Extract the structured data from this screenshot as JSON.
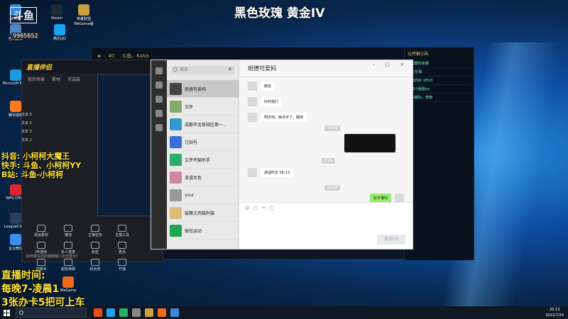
{
  "stream": {
    "title": "黑色玫瑰 黄金IV",
    "logo_badge": "斗鱼",
    "viewer_count": "9985652"
  },
  "overlays": {
    "socials": [
      "抖音: 小柯柯大魔王",
      "快手: 斗鱼、小柯柯YY",
      "B站: 斗鱼-小柯柯"
    ],
    "schedule": [
      "直播时间:",
      "每晚7-凌晨1",
      "3张办卡5把可上车"
    ]
  },
  "desktop_icons": [
    {
      "label": "此电脑",
      "color": "#3a8ad8"
    },
    {
      "label": "Steam",
      "color": "#1b2838"
    },
    {
      "label": "英雄联盟WeGame版",
      "color": "#c8a040"
    },
    {
      "label": "控制面板",
      "color": "#4f86c6"
    },
    {
      "label": "腾讯QQ",
      "color": "#1ea0f0"
    },
    {
      "label": "Microsoft Edge",
      "color": "#1a9be0"
    },
    {
      "label": "腾讯视频",
      "color": "#ff7a1c"
    },
    {
      "label": "WPS Office",
      "color": "#d8282e"
    },
    {
      "label": "LeagueClient",
      "color": "#2b3e5a"
    },
    {
      "label": "企业微信",
      "color": "#3c8ef0"
    },
    {
      "label": "WeGame",
      "color": "#f06a1c"
    }
  ],
  "helper": {
    "brand": "直播伴侣",
    "tabs": [
      "我的场景",
      "素材",
      "可选装"
    ],
    "scenes": [
      "文本 5",
      "文本 2",
      "文本 3",
      "文本 1"
    ],
    "tools": [
      "添加素材",
      "推流",
      "主播任务",
      "主播工具",
      "PK连线",
      "多人连麦",
      "抢星",
      "更多",
      "直播间",
      "超级弹幕",
      "粉丝团",
      "开播"
    ],
    "footer": "如何把左边的视频窗口点击放大?"
  },
  "wechat": {
    "search_placeholder": "搜索",
    "chats": [
      {
        "name": "斑德可爱妈",
        "sub": "",
        "color": "#444",
        "active": true
      },
      {
        "name": "文件",
        "sub": "",
        "color": "#8a6",
        "active": false
      },
      {
        "name": "成都市龙泉驿区第一...",
        "sub": "",
        "color": "#39c",
        "active": false
      },
      {
        "name": "订阅号",
        "sub": "",
        "color": "#3a6fd8",
        "active": false
      },
      {
        "name": "文件传输助手",
        "sub": "",
        "color": "#2aae67",
        "active": false
      },
      {
        "name": "浪漫月色",
        "sub": "",
        "color": "#c89",
        "active": false
      },
      {
        "name": "your",
        "sub": "",
        "color": "#999",
        "active": false
      },
      {
        "name": "鼓舞文西猫利猫",
        "sub": "",
        "color": "#db7",
        "active": false
      },
      {
        "name": "微信运动",
        "sub": "",
        "color": "#1fa653",
        "active": false
      }
    ],
    "chat_title": "斑德可爱妈",
    "window_buttons": "– □ ×",
    "messages": [
      {
        "text": "微信",
        "side": "left"
      },
      {
        "text": "好的我们",
        "side": "left"
      },
      {
        "text": "明天吧，两点半了，睡吧",
        "side": "left"
      },
      {
        "text": "通话时长 56:13",
        "side": "left"
      },
      {
        "text": "玩不懂吗",
        "side": "right"
      }
    ],
    "time_tags": [
      "18:01",
      "7:24",
      "13:28"
    ],
    "toolbar_icons": [
      "☺",
      "▢",
      "✂",
      "◯"
    ],
    "send_label": "发送(S)"
  },
  "game": {
    "topbar": [
      "◈",
      "40",
      "斗鱼、Kaka"
    ],
    "right_title": "公开群小队",
    "right_items": [
      "好想要的余额",
      "意见互相",
      "已是你好 1H10",
      "辅导小姐姐ey",
      "越来越好，宠物"
    ]
  },
  "taskbar": {
    "clock_time": "20:13",
    "clock_date": "2022/7/24",
    "app_colors": [
      "#e84c1c",
      "#1ea0f0",
      "#2aae67",
      "#888",
      "#c8a040",
      "#f06a1c",
      "#3a8ad8"
    ]
  }
}
